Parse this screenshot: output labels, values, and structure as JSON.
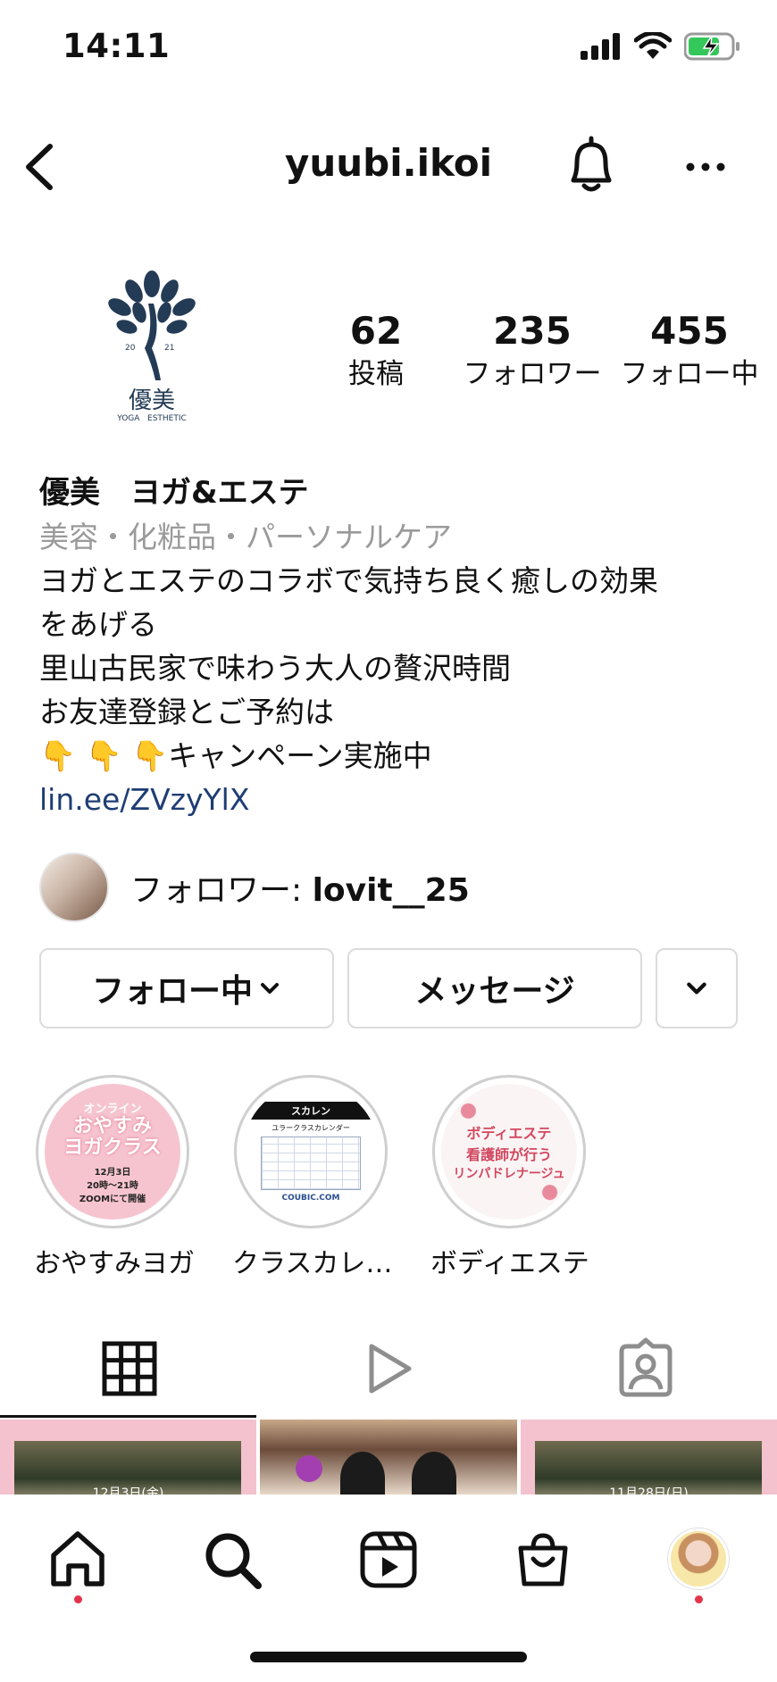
{
  "status_bar": {
    "time": "14:11"
  },
  "header": {
    "username": "yuubi.ikoi"
  },
  "profile": {
    "logo_text": "優美",
    "logo_sub": "YOGA   ESTHETIC",
    "logo_year_left": "20",
    "logo_year_right": "21",
    "stats": [
      {
        "value": "62",
        "label": "投稿"
      },
      {
        "value": "235",
        "label": "フォロワー"
      },
      {
        "value": "455",
        "label": "フォロー中"
      }
    ]
  },
  "bio": {
    "name": "優美　ヨガ&エステ",
    "category": "美容・化粧品・パーソナルケア",
    "line1": "ヨガとエステのコラボで気持ち良く癒しの効果",
    "line2": "をあげる",
    "line3": "里山古民家で味わう大人の贅沢時間",
    "line4": "お友達登録とご予約は",
    "line5_emoji": "👇 👇 👇",
    "line5_text": "キャンペーン実施中",
    "link": "lin.ee/ZVzyYlX"
  },
  "followed_by": {
    "prefix": "フォロワー: ",
    "user": "lovit__25"
  },
  "buttons": {
    "follow": "フォロー中",
    "message": "メッセージ"
  },
  "highlights": [
    {
      "label": "おやすみヨガ",
      "t1": "オンライン",
      "t2": "おやすみ",
      "t3": "ヨガクラス",
      "t4": "12月3日",
      "t5": "20時〜21時",
      "t6": "ZOOMにて開催"
    },
    {
      "label": "クラスカレ…",
      "t1": "スカレン",
      "t2": "ユラークラスカレンダー",
      "t3": "COUBIC.COM"
    },
    {
      "label": "ボディエステ",
      "t1": "ボディエステ",
      "t2": "看護師が行う",
      "t3": "リンパドレナージュ"
    }
  ],
  "grid": {
    "cell1_caption": "12月3日(金)",
    "cell3_caption": "11月28日(日)"
  },
  "colors": {
    "link": "#1f3d74",
    "category": "#9a9a9a",
    "notification_dot": "#e2344a",
    "highlight_pink": "#f2a7b6"
  }
}
